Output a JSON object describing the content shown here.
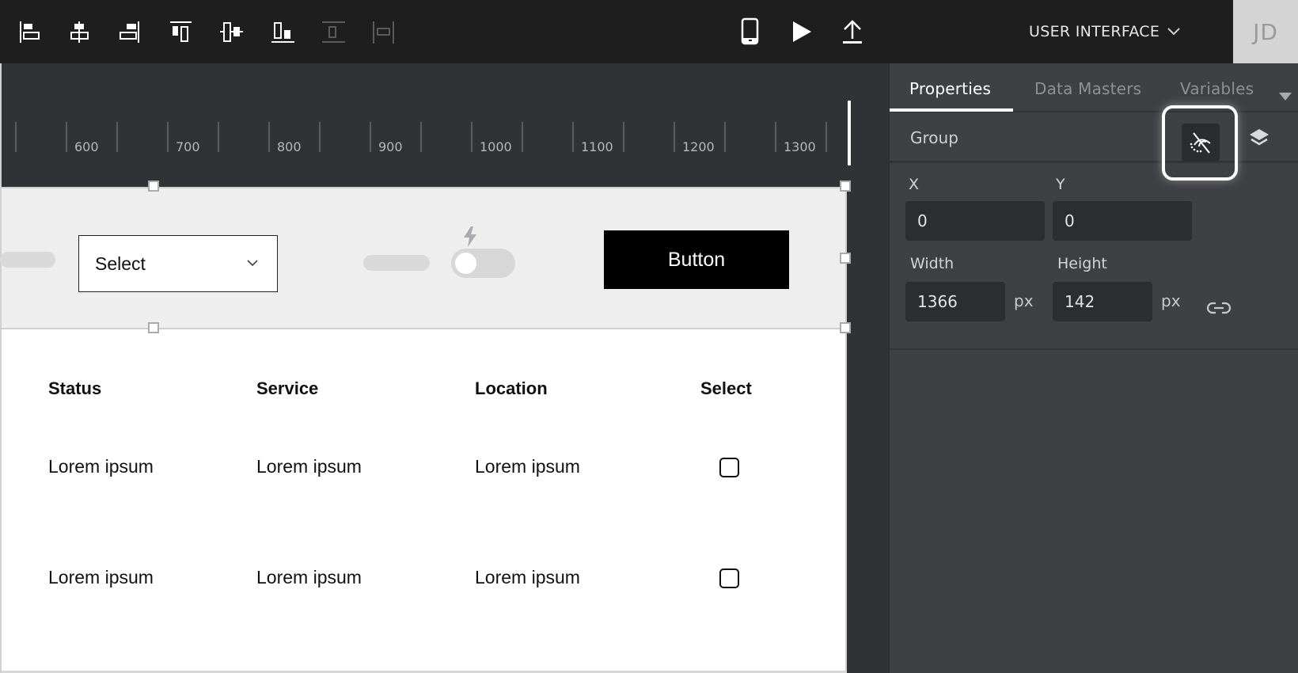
{
  "toolbar": {
    "align_buttons": [
      {
        "name": "align-left",
        "enabled": true
      },
      {
        "name": "align-center-horizontal",
        "enabled": true
      },
      {
        "name": "align-right",
        "enabled": true
      },
      {
        "name": "align-top",
        "enabled": true
      },
      {
        "name": "align-center-vertical",
        "enabled": true
      },
      {
        "name": "align-bottom",
        "enabled": true
      },
      {
        "name": "distribute-vertical",
        "enabled": false
      },
      {
        "name": "distribute-horizontal",
        "enabled": false
      }
    ],
    "actions": [
      {
        "name": "mobile-preview-icon"
      },
      {
        "name": "play-icon"
      },
      {
        "name": "upload-icon"
      }
    ],
    "project_menu_label": "USER INTERFACE",
    "avatar_initials": "JD"
  },
  "ruler": {
    "labels": [
      "600",
      "700",
      "800",
      "900",
      "1000",
      "1100",
      "1200",
      "1300"
    ]
  },
  "canvas": {
    "select": {
      "label": "Select"
    },
    "toggle": {
      "on": false
    },
    "button_label": "Button",
    "table": {
      "headers": [
        "Status",
        "Service",
        "Location",
        "Select"
      ],
      "rows": [
        {
          "status": "Lorem ipsum",
          "service": "Lorem ipsum",
          "location": "Lorem ipsum",
          "checked": false
        },
        {
          "status": "Lorem ipsum",
          "service": "Lorem ipsum",
          "location": "Lorem ipsum",
          "checked": false
        }
      ]
    }
  },
  "panel": {
    "tabs": [
      {
        "label": "Properties",
        "active": true
      },
      {
        "label": "Data Masters",
        "active": false
      },
      {
        "label": "Variables",
        "active": false
      }
    ],
    "selection_type": "Group",
    "fields": {
      "x_label": "X",
      "x_value": "0",
      "y_label": "Y",
      "y_value": "0",
      "width_label": "Width",
      "width_value": "1366",
      "width_unit": "px",
      "height_label": "Height",
      "height_value": "142",
      "height_unit": "px"
    }
  },
  "colors": {
    "topbar": "#1e1e1e",
    "canvas_bg": "#313235",
    "panel_bg": "#3f4044",
    "field_bg": "#2c2d30",
    "group_band": "#eeeeee",
    "accent": "#ffffff"
  }
}
